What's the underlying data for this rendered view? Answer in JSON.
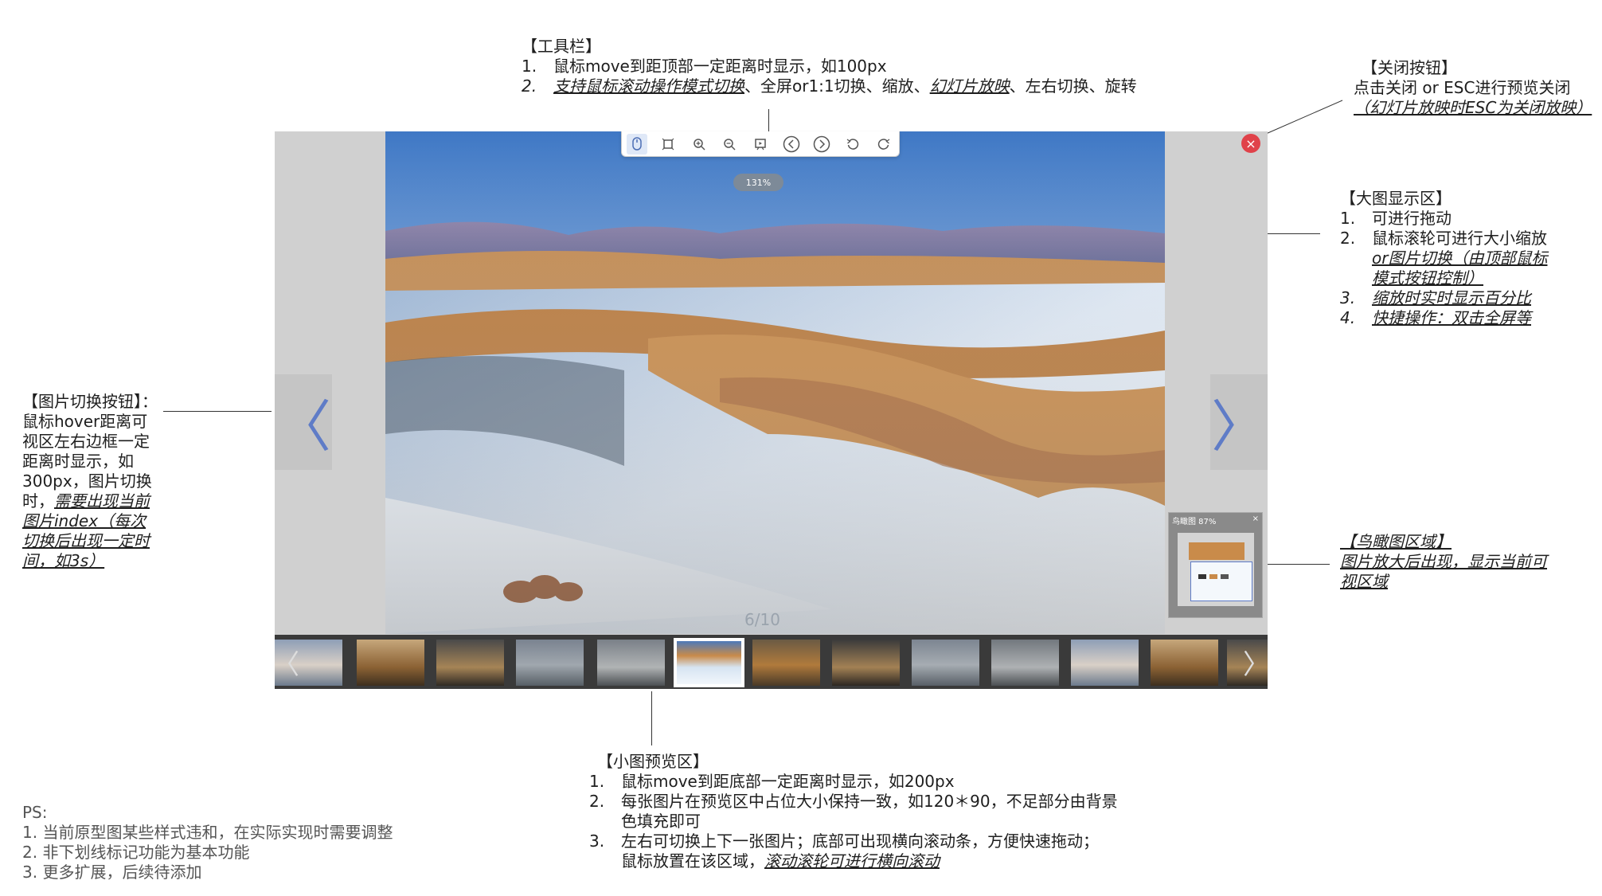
{
  "toolbar_note": {
    "title": "【工具栏】",
    "items": [
      {
        "num": "1.",
        "text": "鼠标move到距顶部一定距离时显示，如100px"
      },
      {
        "num": "2.",
        "link1": "支持鼠标滚动操作模式切换",
        "mid": "、全屏or1:1切换、缩放、",
        "link2": "幻灯片放映",
        "tail": "、左右切换、旋转"
      }
    ]
  },
  "close_note": {
    "title": "【关闭按钮】",
    "line1": "点击关闭 or ESC进行预览关闭",
    "line2": "（幻灯片放映时ESC为关闭放映）"
  },
  "bigimage_note": {
    "title": "【大图显示区】",
    "items": [
      {
        "num": "1.",
        "text": "可进行拖动"
      },
      {
        "num": "2.",
        "text": "鼠标滚轮可进行大小缩放",
        "sub1": "or图片切换（由顶部鼠标",
        "sub2": "模式按钮控制）"
      },
      {
        "num": "3.",
        "text": "缩放时实时显示百分比"
      },
      {
        "num": "4.",
        "text": "快捷操作：双击全屏等"
      }
    ]
  },
  "switch_note": {
    "title": "【图片切换按钮】：",
    "lines": [
      "鼠标hover距离可",
      "视区左右边框一定",
      "距离时显示，如",
      "300px，图片切换"
    ],
    "line5_plain": "时，",
    "line5_link": "需要出现当前",
    "link_lines": [
      "图片index（每次",
      "切换后出现一定时",
      "间，如3s）"
    ]
  },
  "birdview_note": {
    "title": "【鸟瞰图区域】",
    "line1": "图片放大后出现，显示当前可",
    "line2": "视区域"
  },
  "thumb_note": {
    "title": "【小图预览区】",
    "items": [
      {
        "num": "1.",
        "text": "鼠标move到距底部一定距离时显示，如200px"
      },
      {
        "num": "2.",
        "text": "每张图片在预览区中占位大小保持一致，如120＊90，不足部分由背景",
        "text2": "色填充即可"
      },
      {
        "num": "3.",
        "text": "左右可切换上下一张图片；底部可出现横向滚动条，方便快速拖动；",
        "text2": "鼠标放置在该区域，",
        "link": "滚动滚轮可进行横向滚动"
      }
    ]
  },
  "ps_note": {
    "title": "PS:",
    "lines": [
      "1. 当前原型图某些样式违和，在实际实现时需要调整",
      "2. 非下划线标记功能为基本功能",
      "3. 更多扩展，后续待添加"
    ]
  },
  "viewer": {
    "zoom_label": "131%",
    "counter": "6/10",
    "close_symbol": "×",
    "prev_symbol": "〈",
    "next_symbol": "〉",
    "strip_prev": "〈",
    "strip_next": "〉",
    "birdview_title": "鸟瞰图 87%",
    "birdview_close": "×",
    "toolbar_icons": [
      "mouse-mode-icon",
      "fit-screen-icon",
      "zoom-in-icon",
      "zoom-out-icon",
      "slideshow-icon",
      "prev-circle-icon",
      "next-circle-icon",
      "rotate-left-icon",
      "rotate-right-icon"
    ]
  },
  "colors": {
    "viewer_bg": "#d0d0d0",
    "close_red": "#e0424a",
    "arrow_blue": "#5f7cc7",
    "zoom_pill": "#7d8a98"
  }
}
